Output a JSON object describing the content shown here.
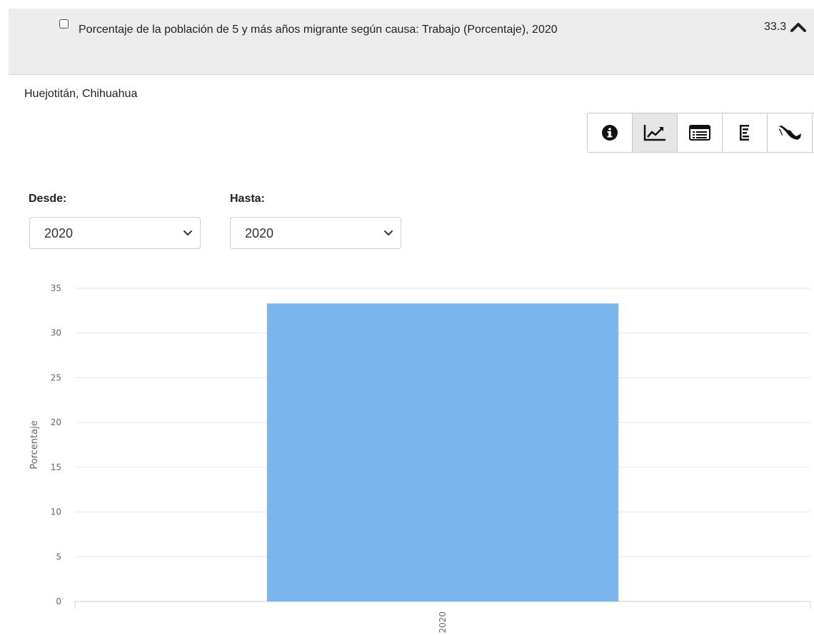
{
  "header": {
    "title": "Porcentaje de la población de 5 y más años migrante según causa: Trabajo (Porcentaje), 2020",
    "value": "33.3"
  },
  "location": "Huejotitán, Chihuahua",
  "toolbar": {
    "buttons": [
      "info-icon",
      "line-chart-icon",
      "table-icon",
      "list-icon",
      "mexico-map-icon"
    ],
    "active": "line-chart-icon"
  },
  "filters": {
    "desde_label": "Desde:",
    "desde_value": "2020",
    "hasta_label": "Hasta:",
    "hasta_value": "2020"
  },
  "colors": {
    "bar": "#7cb5ec",
    "header_bg": "#ececec",
    "grid": "#e6e6e6"
  },
  "chart_data": {
    "type": "bar",
    "categories": [
      "2020"
    ],
    "values": [
      33.3
    ],
    "title": "",
    "xlabel": "",
    "ylabel": "Porcentaje",
    "ylim": [
      0,
      35
    ],
    "yticks": [
      0,
      5,
      10,
      15,
      20,
      25,
      30,
      35
    ],
    "grid": true,
    "legend": "none"
  }
}
